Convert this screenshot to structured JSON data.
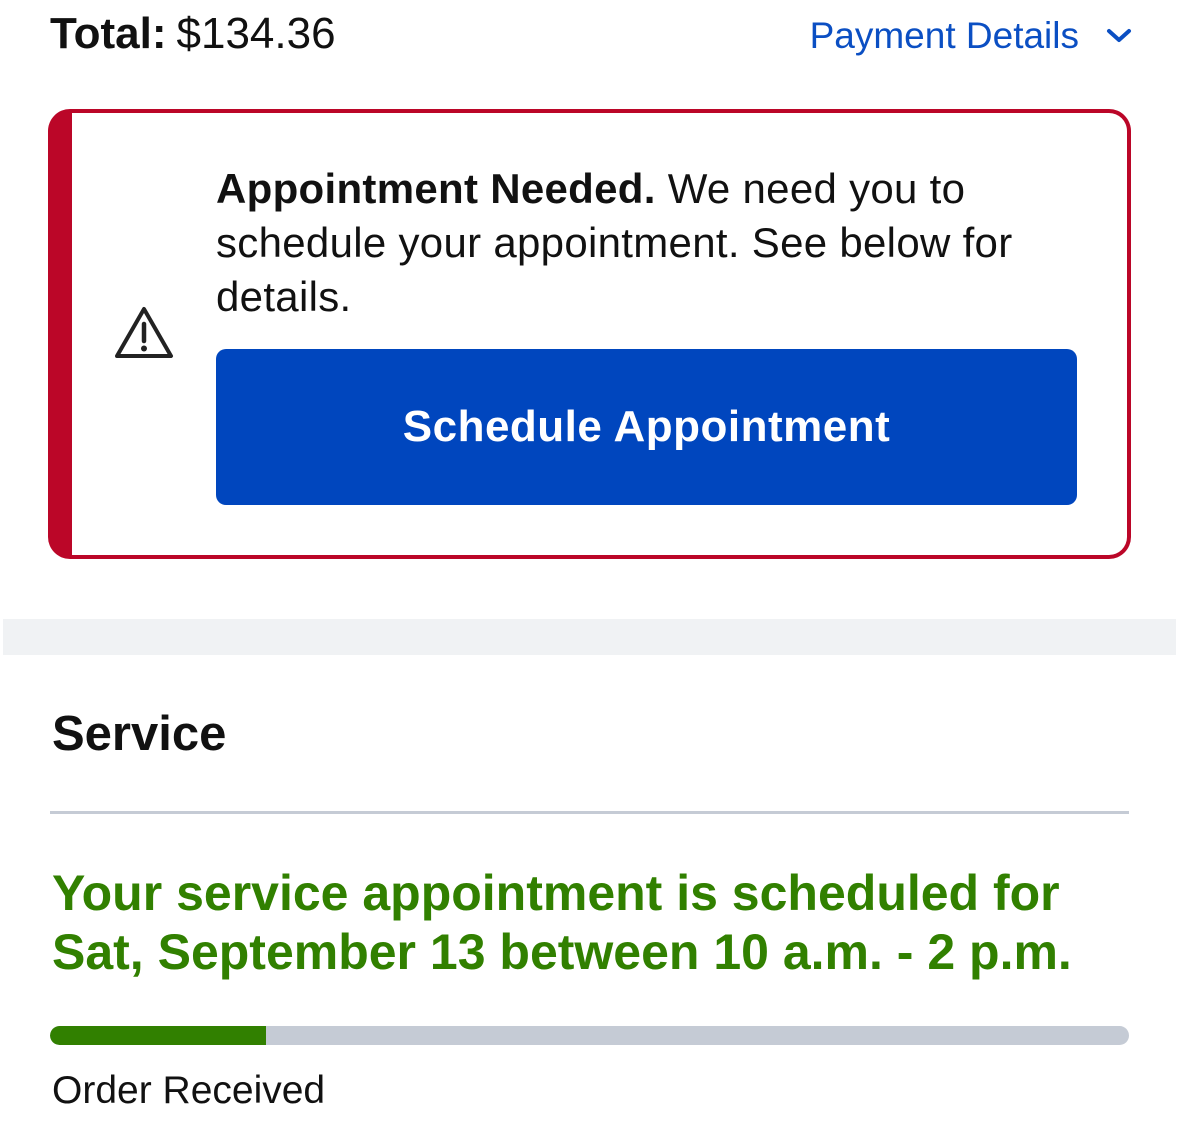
{
  "header": {
    "total_label": "Total:",
    "total_amount": "$134.36",
    "payment_details_label": "Payment Details",
    "link_color": "#0b4fc3"
  },
  "alert": {
    "bold_text": "Appointment Needed.",
    "body_text": " We need you to schedule your appointment. See below for details.",
    "icon": "warning-triangle-icon",
    "border_color": "#bb0628",
    "button_label": "Schedule Appointment",
    "button_color": "#0046be"
  },
  "service": {
    "title": "Service",
    "appointment_text": "Your service appointment is scheduled for Sat, September 13 between 10 a.m. - 2 p.m.",
    "status_color": "#318000",
    "progress_percent": 20,
    "progress_label": "Order Received"
  }
}
